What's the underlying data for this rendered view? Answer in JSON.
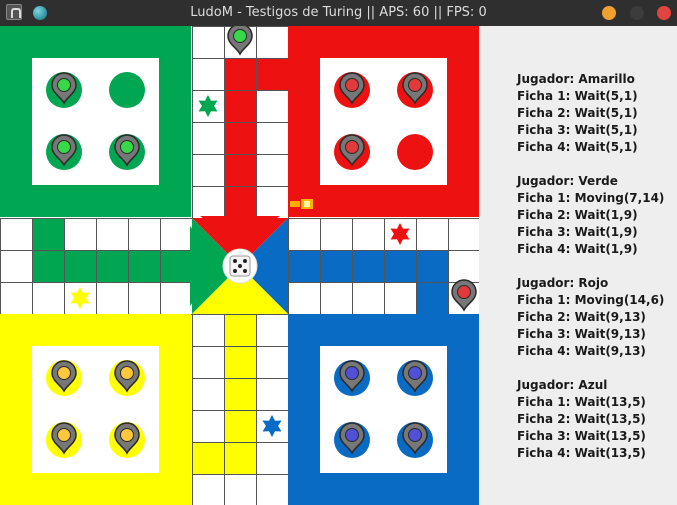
{
  "window": {
    "title": "LudoM - Testigos de Turing || APS: 60 || FPS: 0",
    "buttons": [
      {
        "name": "minimize-button",
        "color": "#f0a030"
      },
      {
        "name": "maximize-button",
        "color": "#3c3c3c"
      },
      {
        "name": "close-button",
        "color": "#e0443e"
      }
    ]
  },
  "colors": {
    "green": "#00a651",
    "red": "#ee1111",
    "yellow": "#ffff00",
    "blue": "#0a6bc4",
    "bright_green": "#37d94a",
    "bright_red": "#e23a3a",
    "bright_yellow": "#ffc83a",
    "bright_blue": "#5050d8",
    "grid_line": "#555555",
    "panel_bg": "#eeeeee"
  },
  "players": [
    {
      "header": "Jugador: Amarillo",
      "pieces": [
        "Ficha 1: Wait(5,1)",
        "Ficha 2: Wait(5,1)",
        "Ficha 3: Wait(5,1)",
        "Ficha 4: Wait(5,1)"
      ]
    },
    {
      "header": "Jugador: Verde",
      "pieces": [
        "Ficha 1: Moving(7,14)",
        "Ficha 2: Wait(1,9)",
        "Ficha 3: Wait(1,9)",
        "Ficha 4: Wait(1,9)"
      ]
    },
    {
      "header": "Jugador: Rojo",
      "pieces": [
        "Ficha 1: Moving(14,6)",
        "Ficha 2: Wait(9,13)",
        "Ficha 3: Wait(9,13)",
        "Ficha 4: Wait(9,13)"
      ]
    },
    {
      "header": "Jugador: Azul",
      "pieces": [
        "Ficha 1: Wait(13,5)",
        "Ficha 2: Wait(13,5)",
        "Ficha 3: Wait(13,5)",
        "Ficha 4: Wait(13,5)"
      ]
    }
  ],
  "board": {
    "die_value": 5
  }
}
